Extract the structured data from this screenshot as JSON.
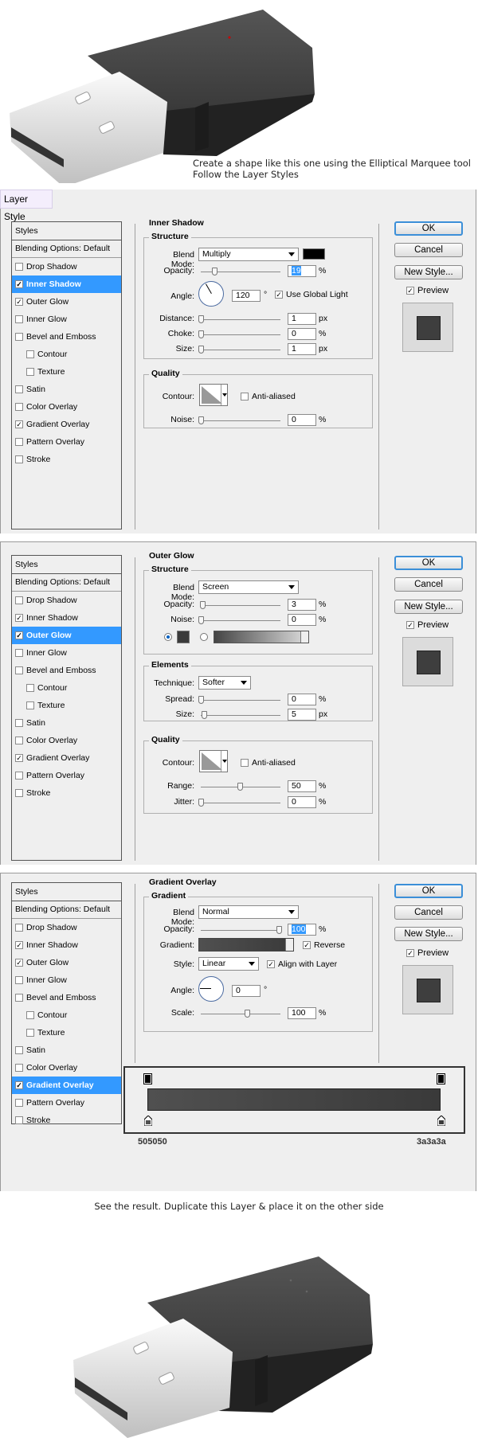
{
  "top_caption": {
    "line1": "Create a shape like this one using the Elliptical Marquee tool",
    "line2": "Follow the Layer Styles"
  },
  "dialog_title": "Layer Style",
  "styles_list": {
    "header": "Styles",
    "blending": "Blending Options: Default",
    "items": [
      {
        "label": "Drop Shadow",
        "checked": false,
        "sub": false
      },
      {
        "label": "Inner Shadow",
        "checked": true,
        "sub": false
      },
      {
        "label": "Outer Glow",
        "checked": true,
        "sub": false
      },
      {
        "label": "Inner Glow",
        "checked": false,
        "sub": false
      },
      {
        "label": "Bevel and Emboss",
        "checked": false,
        "sub": false
      },
      {
        "label": "Contour",
        "checked": false,
        "sub": true
      },
      {
        "label": "Texture",
        "checked": false,
        "sub": true
      },
      {
        "label": "Satin",
        "checked": false,
        "sub": false
      },
      {
        "label": "Color Overlay",
        "checked": false,
        "sub": false
      },
      {
        "label": "Gradient Overlay",
        "checked": true,
        "sub": false
      },
      {
        "label": "Pattern Overlay",
        "checked": false,
        "sub": false
      },
      {
        "label": "Stroke",
        "checked": false,
        "sub": false
      }
    ]
  },
  "buttons": {
    "ok": "OK",
    "cancel": "Cancel",
    "new_style": "New Style...",
    "preview": "Preview"
  },
  "inner_shadow": {
    "title": "Inner Shadow",
    "structure": "Structure",
    "blend_mode_label": "Blend Mode:",
    "blend_mode": "Multiply",
    "opacity_label": "Opacity:",
    "opacity": "19",
    "angle_label": "Angle:",
    "angle": "120",
    "degree": "°",
    "global_light": "Use Global Light",
    "distance_label": "Distance:",
    "distance": "1",
    "choke_label": "Choke:",
    "choke": "0",
    "size_label": "Size:",
    "size": "1",
    "quality": "Quality",
    "contour_label": "Contour:",
    "anti_aliased": "Anti-aliased",
    "noise_label": "Noise:",
    "noise": "0",
    "pct": "%",
    "px": "px",
    "color": "#000000"
  },
  "outer_glow": {
    "title": "Outer Glow",
    "structure": "Structure",
    "blend_mode_label": "Blend Mode:",
    "blend_mode": "Screen",
    "opacity_label": "Opacity:",
    "opacity": "3",
    "noise_label": "Noise:",
    "noise": "0",
    "elements": "Elements",
    "technique_label": "Technique:",
    "technique": "Softer",
    "spread_label": "Spread:",
    "spread": "0",
    "size_label": "Size:",
    "size": "5",
    "quality": "Quality",
    "contour_label": "Contour:",
    "anti_aliased": "Anti-aliased",
    "range_label": "Range:",
    "range": "50",
    "jitter_label": "Jitter:",
    "jitter": "0",
    "pct": "%",
    "px": "px",
    "color": "#3a3a3a"
  },
  "gradient_overlay": {
    "title": "Gradient Overlay",
    "gradient_section": "Gradient",
    "blend_mode_label": "Blend Mode:",
    "blend_mode": "Normal",
    "opacity_label": "Opacity:",
    "opacity": "100",
    "gradient_label": "Gradient:",
    "reverse": "Reverse",
    "style_label": "Style:",
    "style": "Linear",
    "align": "Align with Layer",
    "angle_label": "Angle:",
    "angle": "0",
    "degree": "°",
    "scale_label": "Scale:",
    "scale": "100",
    "pct": "%",
    "stop_left": "505050",
    "stop_right": "3a3a3a",
    "color_left": "#505050",
    "color_right": "#3a3a3a"
  },
  "bottom_caption": "See the result. Duplicate this Layer & place it on the other side"
}
